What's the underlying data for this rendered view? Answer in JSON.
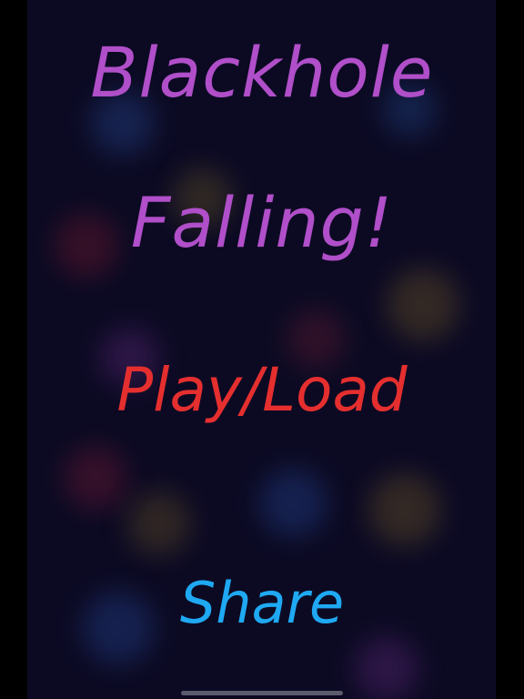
{
  "title": {
    "line1": "Blackhole",
    "line2": "Falling!"
  },
  "menu": {
    "play_label": "Play/Load",
    "share_label": "Share"
  },
  "colors": {
    "title": "#b04fc9",
    "play": "#e52f2f",
    "share": "#1fa9f3",
    "background": "#0c0a23"
  }
}
